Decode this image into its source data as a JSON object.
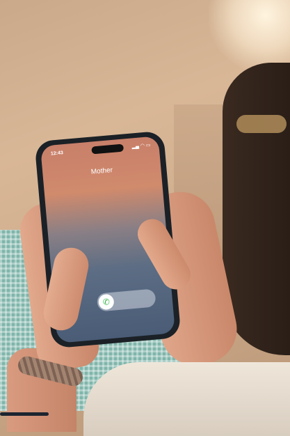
{
  "phone": {
    "status_time": "12:43",
    "status_icons": "signal-wifi-battery",
    "caller_name": "Mother",
    "answer_icon": "phone-icon",
    "accent": "#3bb54a"
  }
}
